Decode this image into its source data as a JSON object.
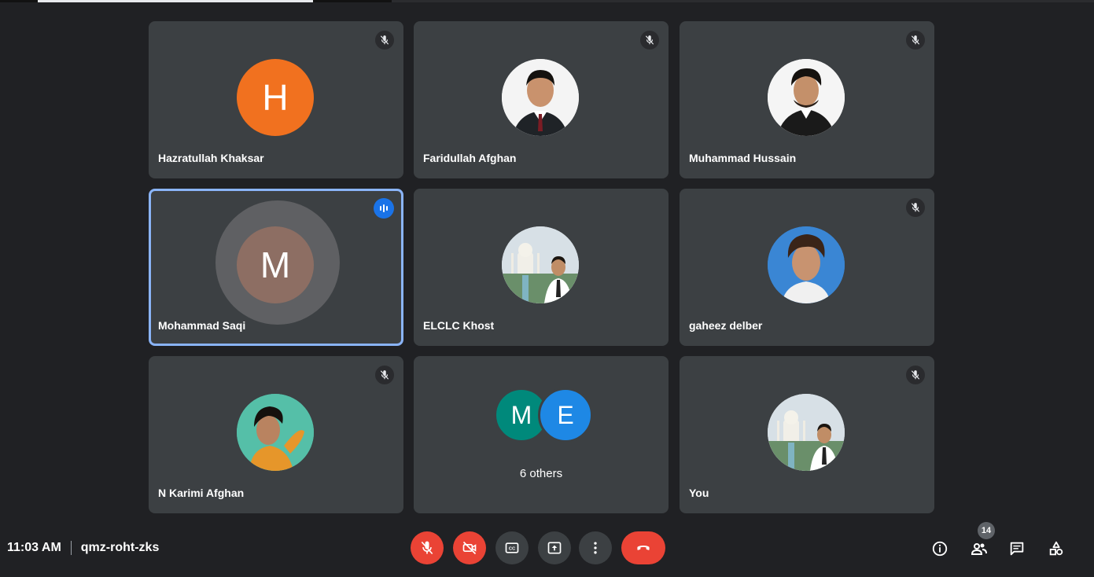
{
  "participants": [
    {
      "name": "Hazratullah Khaksar",
      "initial": "H",
      "avatar_color": "#f1711f",
      "muted": true
    },
    {
      "name": "Faridullah Afghan",
      "muted": true,
      "photo": "photo-avatar"
    },
    {
      "name": "Muhammad Hussain",
      "muted": true,
      "photo": "photo-avatar"
    },
    {
      "name": "Mohammad Saqi",
      "initial": "M",
      "avatar_color": "#8d6e63",
      "speaking": true
    },
    {
      "name": "ELCLC Khost",
      "photo": "photo-avatar"
    },
    {
      "name": "gaheez delber",
      "muted": true,
      "photo": "photo-avatar"
    },
    {
      "name": "N Karimi Afghan",
      "muted": true,
      "photo": "photo-avatar"
    },
    {
      "others_label": "6 others",
      "initials": [
        "M",
        "E"
      ],
      "colors": [
        "#00897b",
        "#1e88e5"
      ]
    },
    {
      "name": "You",
      "muted": true,
      "photo": "photo-avatar"
    }
  ],
  "meeting": {
    "time": "11:03 AM",
    "code": "qmz-roht-zks"
  },
  "controls": {
    "mic": "mic-off-icon",
    "camera": "camera-off-icon",
    "captions": "captions-icon",
    "present": "present-icon",
    "more": "more-options-icon",
    "leave": "leave-call-icon"
  },
  "right_controls": {
    "people_count": "14"
  },
  "colors": {
    "background": "#202124",
    "tile": "#3c4043",
    "red": "#ea4335",
    "accent": "#8ab4f8"
  }
}
